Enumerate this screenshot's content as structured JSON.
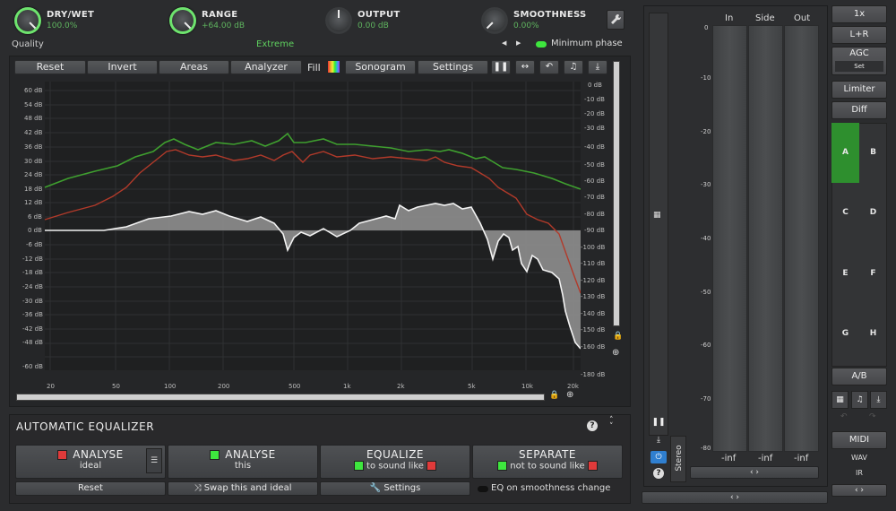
{
  "top": {
    "dry_wet": {
      "label": "DRY/WET",
      "value": "100.0%"
    },
    "range": {
      "label": "RANGE",
      "value": "+64.00 dB"
    },
    "output": {
      "label": "OUTPUT",
      "value": "0.00 dB"
    },
    "smoothness": {
      "label": "SMOOTHNESS",
      "value": "0.00%"
    },
    "quality_label": "Quality",
    "quality_value": "Extreme",
    "min_phase_label": "Minimum phase",
    "arrow_left": "◀",
    "arrow_right": "▶"
  },
  "toolbar": {
    "reset": "Reset",
    "invert": "Invert",
    "areas": "Areas",
    "analyzer": "Analyzer",
    "fill": "Fill",
    "sonogram": "Sonogram",
    "settings": "Settings"
  },
  "graph": {
    "left_db": [
      "60 dB",
      "54 dB",
      "48 dB",
      "42 dB",
      "36 dB",
      "30 dB",
      "24 dB",
      "18 dB",
      "12 dB",
      "6 dB",
      "0 dB",
      "-6 dB",
      "-12 dB",
      "-18 dB",
      "-24 dB",
      "-30 dB",
      "-36 dB",
      "-42 dB",
      "-48 dB",
      "-60 dB"
    ],
    "right_db": [
      "0 dB",
      "-10 dB",
      "-20 dB",
      "-30 dB",
      "-40 dB",
      "-50 dB",
      "-60 dB",
      "-70 dB",
      "-80 dB",
      "-90 dB",
      "-100 dB",
      "-110 dB",
      "-120 dB",
      "-130 dB",
      "-140 dB",
      "-150 dB",
      "-160 dB",
      "-180 dB"
    ],
    "freq": [
      "20",
      "50",
      "100",
      "200",
      "500",
      "1k",
      "2k",
      "5k",
      "10k",
      "20k"
    ],
    "colors": {
      "green": "#3f9f2f",
      "red": "#b23a2a",
      "fill": "#8e8e8e"
    }
  },
  "auto_eq": {
    "title": "AUTOMATIC EQUALIZER",
    "analyse1": {
      "label": "ANALYSE",
      "sub": "ideal"
    },
    "analyse2": {
      "label": "ANALYSE",
      "sub": "this"
    },
    "equalize": {
      "label": "EQUALIZE",
      "sub": "to sound like"
    },
    "separate": {
      "label": "SEPARATE",
      "sub": "not to sound like"
    },
    "reset": "Reset",
    "swap": "Swap this and ideal",
    "settings": "Settings",
    "eq_smooth": "EQ on smoothness change",
    "colors": {
      "red": "#e03a3a",
      "green": "#3ee63e"
    }
  },
  "meter": {
    "cols": [
      "In",
      "Side",
      "Out"
    ],
    "scale": [
      "0",
      "-10",
      "-20",
      "-30",
      "-40",
      "-50",
      "-60",
      "-70",
      "-80"
    ],
    "values": [
      "-inf",
      "-inf",
      "-inf"
    ],
    "stereo": "Stereo",
    "expand": "‹ ›"
  },
  "right": {
    "zoom": "1x",
    "lr": "L+R",
    "agc": "AGC",
    "agc_set": "Set",
    "limiter": "Limiter",
    "diff": "Diff",
    "slots": [
      "A",
      "B",
      "C",
      "D",
      "E",
      "F",
      "G",
      "H"
    ],
    "ab": "A/B",
    "midi": "MIDI",
    "wav": "WAV",
    "ir": "IR",
    "expand": "‹ ›",
    "active_color": "#2e8f2e"
  }
}
